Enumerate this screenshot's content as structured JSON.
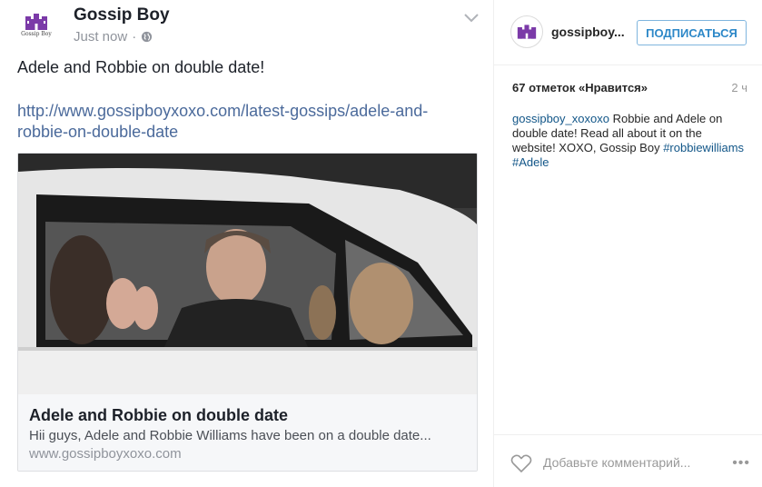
{
  "post": {
    "page_name": "Gossip Boy",
    "timestamp": "Just now",
    "separator": "·",
    "logo_text": "Gossip Boy",
    "text": "Adele and Robbie on double date!",
    "link": "http://www.gossipboyxoxo.com/latest-gossips/adele-and-robbie-on-double-date",
    "card": {
      "title": "Adele and Robbie on double date",
      "description": "Hii guys, Adele and Robbie Williams have been on a double date...",
      "domain": "www.gossipboyxoxo.com"
    },
    "colors": {
      "link": "#4b6a9b",
      "logo_purple": "#7b3aa8"
    }
  },
  "instagram": {
    "username": "gossipboy...",
    "follow_label": "ПОДПИСАТЬСЯ",
    "likes": "67 отметок «Нравится»",
    "time": "2 ч",
    "caption": {
      "user": "gossipboy_xoxoxo",
      "text": " Robbie and Adele on double date! Read all about it on the website! XOXO, Gossip Boy ",
      "tag1": "#robbiewilliams",
      "tag2": "#Adele"
    },
    "comment_placeholder": "Добавьте комментарий...",
    "more": "•••"
  }
}
